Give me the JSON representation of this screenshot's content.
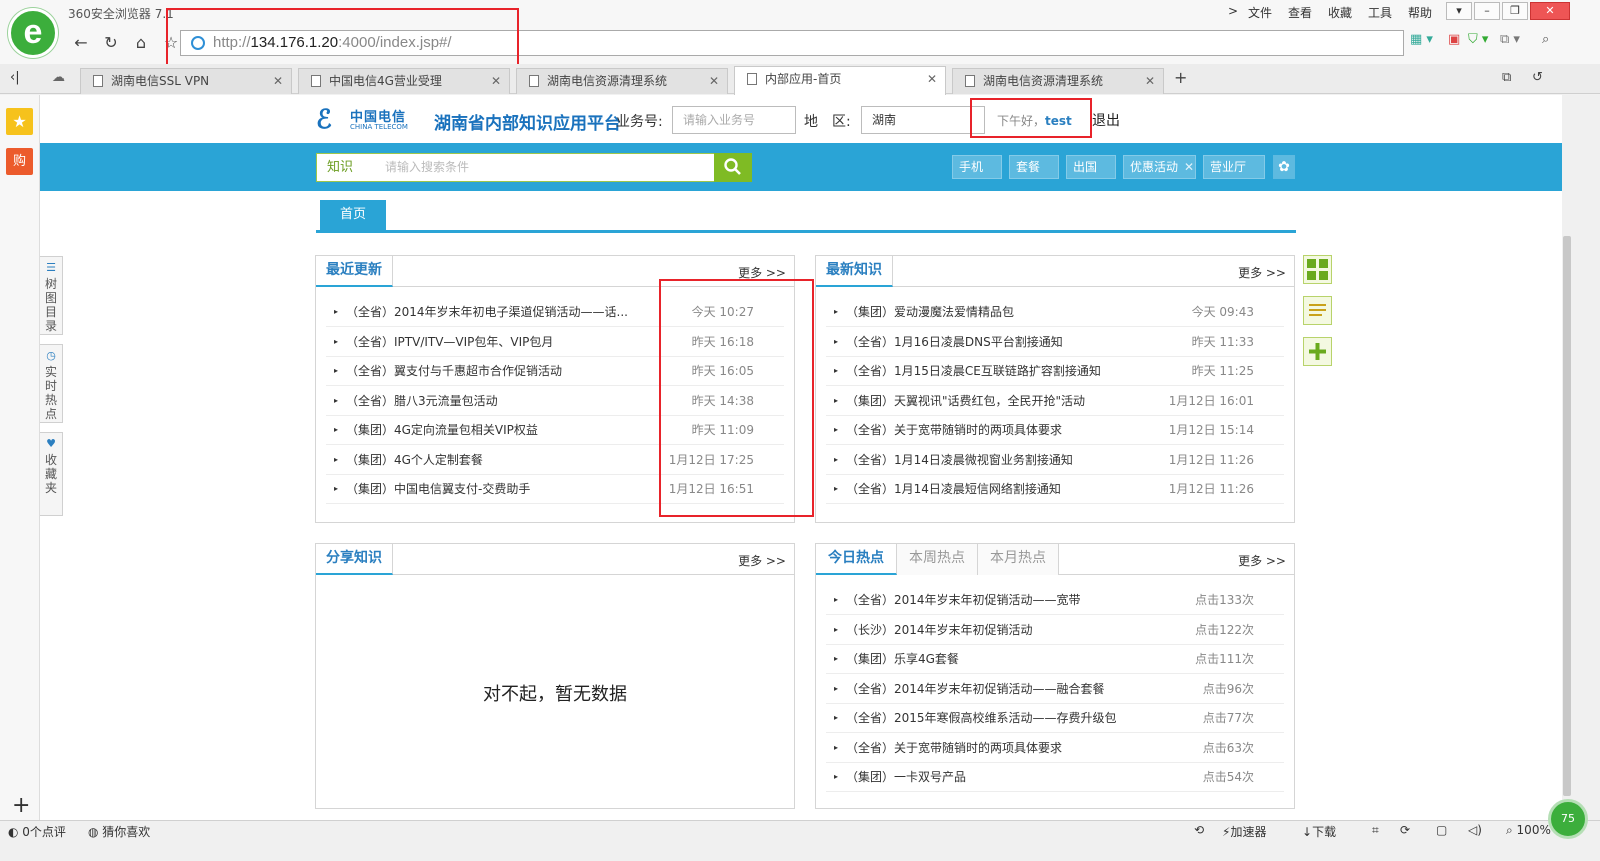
{
  "browser": {
    "brand": "360安全浏览器 7.1",
    "menu": [
      "文件",
      "查看",
      "收藏",
      "工具",
      "帮助"
    ],
    "url_host": "http://",
    "url_ip": "134.176.1.20",
    "url_rest": ":4000/index.jsp#/",
    "tabs": [
      {
        "label": "湖南电信SSL VPN"
      },
      {
        "label": "中国电信4G营业受理"
      },
      {
        "label": "湖南电信资源清理系统"
      },
      {
        "label": "内部应用-首页"
      },
      {
        "label": "湖南电信资源清理系统"
      }
    ],
    "active_tab_index": 3,
    "left_icons": {
      "fav": "★",
      "shop": "购"
    },
    "vtabs": [
      {
        "icon": "☰",
        "label": "树图目录"
      },
      {
        "icon": "◷",
        "label": "实时热点"
      },
      {
        "icon": "♥",
        "label": "收藏夹"
      }
    ],
    "status": {
      "comments": "0个点评",
      "guess": "猜你喜欢",
      "accelerator": "加速器",
      "download": "下载",
      "zoom": "100%",
      "badge": "75"
    }
  },
  "header": {
    "logo_cn": "中国电信",
    "logo_en": "CHINA TELECOM",
    "platform": "湖南省内部知识应用平台",
    "biz_label": "业务号:",
    "biz_placeholder": "请输入业务号",
    "region_label": "地　区:",
    "region_value": "湖南",
    "greeting": "下午好，",
    "user": "test",
    "logout": "退出"
  },
  "search": {
    "category": "知识",
    "placeholder": "请输入搜索条件"
  },
  "quick_tags": [
    {
      "label": "手机",
      "closable": false
    },
    {
      "label": "套餐",
      "closable": false
    },
    {
      "label": "出国",
      "closable": false
    },
    {
      "label": "优惠活动",
      "closable": true
    },
    {
      "label": "营业厅",
      "closable": false
    }
  ],
  "home_tab": "首页",
  "more_label": "更多 >>",
  "panels": {
    "recent": {
      "title": "最近更新",
      "rows": [
        {
          "text": "（全省）2014年岁末年初电子渠道促销活动——话...",
          "time": "今天 10:27"
        },
        {
          "text": "（全省）IPTV/ITV—VIP包年、VIP包月",
          "time": "昨天 16:18"
        },
        {
          "text": "（全省）翼支付与千惠超市合作促销活动",
          "time": "昨天 16:05"
        },
        {
          "text": "（全省）腊八3元流量包活动",
          "time": "昨天 14:38"
        },
        {
          "text": "（集团）4G定向流量包相关VIP权益",
          "time": "昨天 11:09"
        },
        {
          "text": "（集团）4G个人定制套餐",
          "time": "1月12日 17:25"
        },
        {
          "text": "（集团）中国电信翼支付-交费助手",
          "time": "1月12日 16:51"
        }
      ]
    },
    "newest": {
      "title": "最新知识",
      "rows": [
        {
          "text": "（集团）爱动漫魔法爱情精品包",
          "time": "今天 09:43"
        },
        {
          "text": "（全省）1月16日凌晨DNS平台割接通知",
          "time": "昨天 11:33"
        },
        {
          "text": "（全省）1月15日凌晨CE互联链路扩容割接通知",
          "time": "昨天 11:25"
        },
        {
          "text": "（集团）天翼视讯\"话费红包，全民开抢\"活动",
          "time": "1月12日 16:01"
        },
        {
          "text": "（全省）关于宽带随销时的两项具体要求",
          "time": "1月12日 15:14"
        },
        {
          "text": "（全省）1月14日凌晨微视窗业务割接通知",
          "time": "1月12日 11:26"
        },
        {
          "text": "（全省）1月14日凌晨短信网络割接通知",
          "time": "1月12日 11:26"
        }
      ]
    },
    "share": {
      "title": "分享知识",
      "empty": "对不起，暂无数据"
    },
    "hot": {
      "tabs": [
        "今日热点",
        "本周热点",
        "本月热点"
      ],
      "rows": [
        {
          "text": "（全省）2014年岁末年初促销活动——宽带",
          "time": "点击133次"
        },
        {
          "text": "（长沙）2014年岁末年初促销活动",
          "time": "点击122次"
        },
        {
          "text": "（集团）乐享4G套餐",
          "time": "点击111次"
        },
        {
          "text": "（全省）2014年岁末年初促销活动——融合套餐",
          "time": "点击96次"
        },
        {
          "text": "（全省）2015年寒假高校维系活动——存费升级包",
          "time": "点击77次"
        },
        {
          "text": "（全省）关于宽带随销时的两项具体要求",
          "time": "点击63次"
        },
        {
          "text": "（集团）一卡双号产品",
          "time": "点击54次"
        }
      ]
    }
  },
  "colors": {
    "accent": "#2aa4d6",
    "title_blue": "#2a7fc0",
    "search_green": "#7fbb24",
    "highlight_red": "#e8232a"
  }
}
